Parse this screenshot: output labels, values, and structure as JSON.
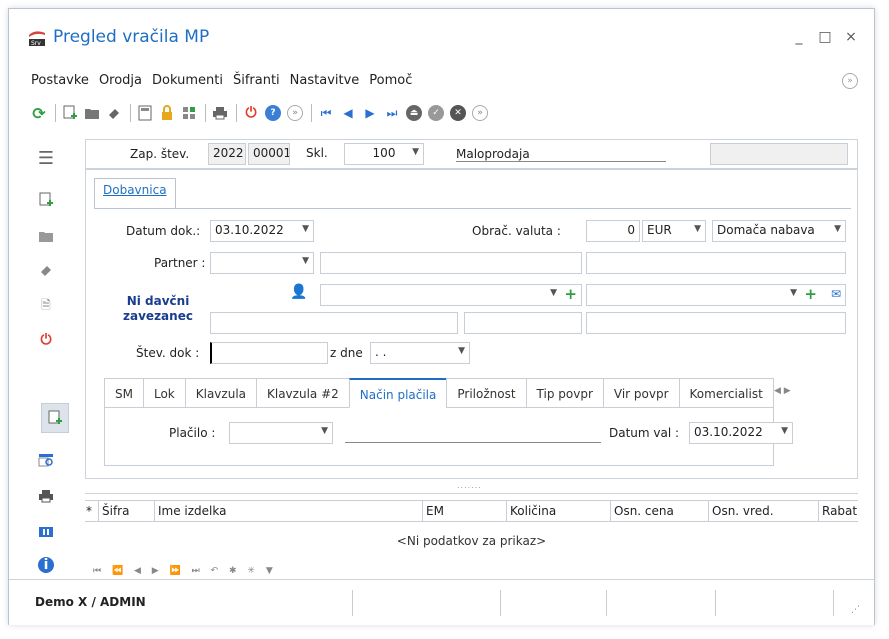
{
  "window": {
    "title": "Pregled vračila MP"
  },
  "menu": [
    "Postavke",
    "Orodja",
    "Dokumenti",
    "Šifranti",
    "Nastavitve",
    "Pomoč"
  ],
  "header": {
    "zap_stev_label": "Zap. štev.",
    "year": "2022",
    "number": "00001",
    "skl_label": "Skl.",
    "skl_value": "100",
    "skl_name": "Maloprodaja"
  },
  "tab_main": "Dobavnica",
  "form": {
    "datum_dok_label": "Datum dok.:",
    "datum_dok": "03.10.2022",
    "obrac_valuta_label": "Obrač. valuta :",
    "valuta_amount": "0",
    "valuta": "EUR",
    "nabava": "Domača nabava",
    "partner_label": "Partner :",
    "davcni": "Ni davčni zavezanec",
    "stev_dok_label": "Štev. dok :",
    "z_dne_label": "z dne",
    "z_dne_value": ". ."
  },
  "subtabs": [
    "SM",
    "Lok",
    "Klavzula",
    "Klavzula #2",
    "Način plačila",
    "Priložnost",
    "Tip povpr",
    "Vir povpr",
    "Komercialist"
  ],
  "subtab_active": 4,
  "payment": {
    "placilo_label": "Plačilo :",
    "datum_val_label": "Datum val :",
    "datum_val": "03.10.2022"
  },
  "grid": {
    "columns": [
      "Šifra",
      "Ime izdelka",
      "EM",
      "Količina",
      "Osn. cena",
      "Osn. vred.",
      "Rabat"
    ],
    "empty": "<Ni podatkov za prikaz>"
  },
  "status": {
    "user": "Demo X / ADMIN"
  },
  "colors": {
    "accent": "#1e6fc4",
    "refresh": "#2ea043",
    "power": "#e23b2e",
    "help": "#3a7fd5"
  }
}
